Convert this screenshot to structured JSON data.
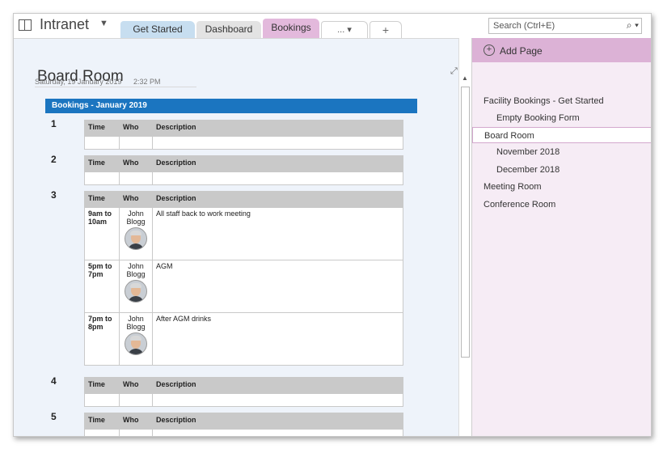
{
  "notebook": {
    "title": "Intranet",
    "caret": "▼"
  },
  "tabs": [
    {
      "label": "Get Started"
    },
    {
      "label": "Dashboard"
    },
    {
      "label": "Bookings"
    },
    {
      "label": "... ▾"
    },
    {
      "label": "+"
    }
  ],
  "search": {
    "placeholder": "Search (Ctrl+E)",
    "icon": "⌕ ▾"
  },
  "page": {
    "title": "Board Room",
    "date": "Saturday, 19 January 2019",
    "time": "2:32 PM",
    "banner": "Bookings - January 2019",
    "headers": {
      "time": "Time",
      "who": "Who",
      "description": "Description"
    },
    "days": [
      {
        "num": "1"
      },
      {
        "num": "2"
      },
      {
        "num": "3",
        "bookings": [
          {
            "time": "9am to 10am",
            "who": "John Blogg",
            "description": "All staff back to work meeting"
          },
          {
            "time": "5pm to 7pm",
            "who": "John Blogg",
            "description": "AGM"
          },
          {
            "time": "7pm to 8pm",
            "who": "John Blogg",
            "description": "After AGM drinks"
          }
        ]
      },
      {
        "num": "4"
      },
      {
        "num": "5"
      }
    ]
  },
  "pages_pane": {
    "add_page": "Add Page",
    "items": [
      {
        "label": "Facility Bookings - Get Started"
      },
      {
        "label": "Empty Booking Form"
      },
      {
        "label": "Board Room"
      },
      {
        "label": "November 2018"
      },
      {
        "label": "December 2018"
      },
      {
        "label": "Meeting Room"
      },
      {
        "label": "Conference Room"
      }
    ]
  },
  "colors": {
    "banner": "#1b75c0",
    "bookings_tab": "#e3b9dc",
    "pane": "#f6ecf5",
    "add_page_bar": "#dcb2d6"
  }
}
